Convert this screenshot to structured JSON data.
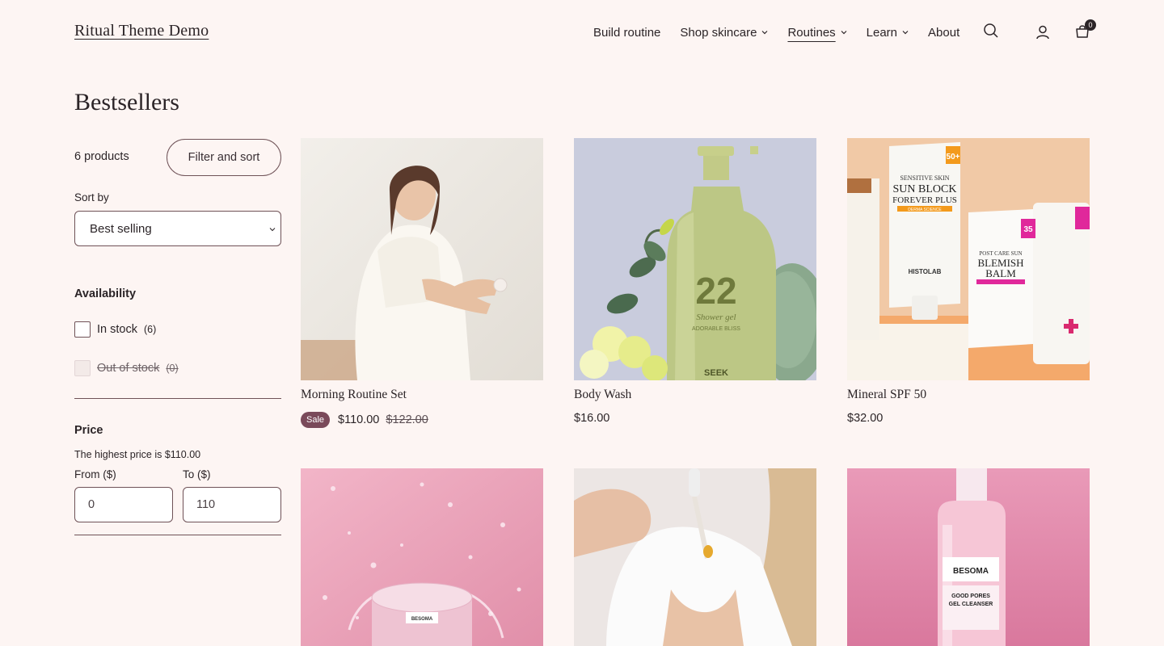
{
  "header": {
    "logo": "Ritual Theme Demo",
    "nav": [
      {
        "label": "Build routine",
        "dropdown": false
      },
      {
        "label": "Shop skincare",
        "dropdown": true
      },
      {
        "label": "Routines",
        "dropdown": true,
        "active": true
      },
      {
        "label": "Learn",
        "dropdown": true
      },
      {
        "label": "About",
        "dropdown": false
      }
    ],
    "icons": [
      "search-icon",
      "account-icon",
      "cart-icon"
    ],
    "cart_count": "0"
  },
  "page": {
    "title": "Bestsellers"
  },
  "sidebar": {
    "product_count": "6 products",
    "filter_button": "Filter and sort",
    "sort_label": "Sort by",
    "sort_value": "Best selling",
    "availability": {
      "title": "Availability",
      "options": [
        {
          "label": "In stock",
          "count": "(6)",
          "disabled": false
        },
        {
          "label": "Out of stock",
          "count": "(0)",
          "disabled": true
        }
      ]
    },
    "price": {
      "title": "Price",
      "note": "The highest price is $110.00",
      "from_label": "From ($)",
      "to_label": "To ($)",
      "from_placeholder": "0",
      "to_placeholder": "110"
    }
  },
  "products": [
    {
      "name": "Morning Routine Set",
      "badge": "Sale",
      "price": "$110.00",
      "compare_price": "$122.00"
    },
    {
      "name": "Body Wash",
      "price": "$16.00"
    },
    {
      "name": "Mineral SPF 50",
      "price": "$32.00"
    },
    {
      "name": "",
      "price": ""
    },
    {
      "name": "",
      "price": ""
    },
    {
      "name": "",
      "price": ""
    }
  ],
  "product_image_text": {
    "p2": {
      "number": "22",
      "script": "Shower gel",
      "tag": "ADORABLE BLISS",
      "brand": "SEEK"
    },
    "p3": {
      "t1": "SENSITIVE SKIN",
      "t2": "SUN BLOCK",
      "t3": "FOREVER PLUS",
      "t4": "DERMA SCIENCE",
      "spf": "50+",
      "brand": "HISTOLAB",
      "b1": "POST CARE SUN",
      "b2": "BLEMISH",
      "b3": "BALM",
      "spf2": "35"
    },
    "p4": {
      "brand": "BESOMA"
    },
    "p6": {
      "brand": "BESOMA",
      "l1": "GOOD PORES",
      "l2": "GEL CLEANSER"
    }
  },
  "colors": {
    "background": "#fdf5f3",
    "text": "#2b2427",
    "border": "#6f5257",
    "sale_badge": "#7a4a5a"
  }
}
